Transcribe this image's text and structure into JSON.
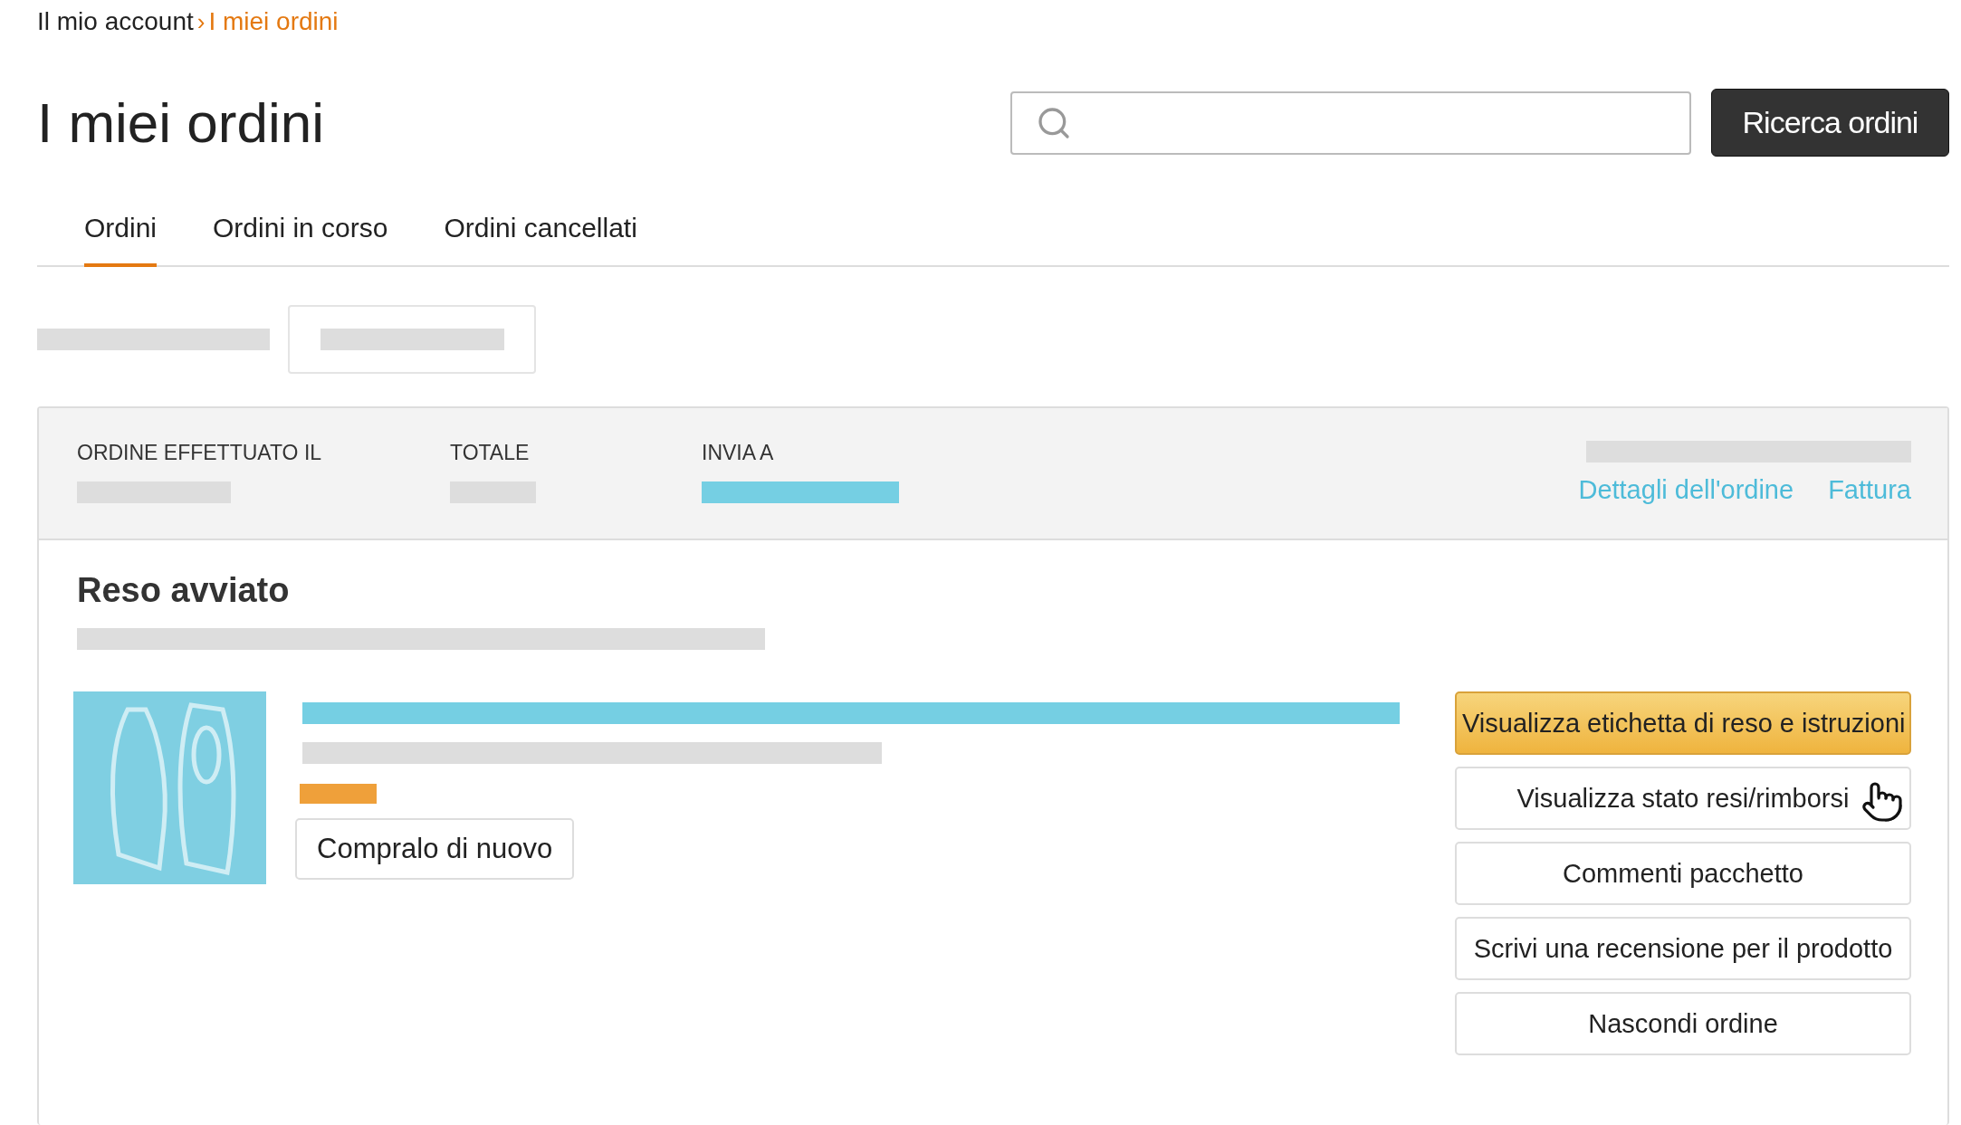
{
  "breadcrumb": [
    {
      "label": "Il mio account",
      "selected": false
    },
    {
      "label": "I miei ordini",
      "selected": true
    }
  ],
  "breadcrumb_separator": "›",
  "title": "I miei ordini",
  "search": {
    "button": "Ricerca ordini"
  },
  "tabs": [
    {
      "label": "Ordini",
      "selected": true
    },
    {
      "label": "Ordini in corso",
      "selected": false
    },
    {
      "label": "Ordini cancellati",
      "selected": false
    }
  ],
  "order": {
    "header": {
      "columns": [
        "ORDINE EFFETTUATO IL",
        "TOTALE",
        "INVIA A"
      ],
      "links": [
        "Dettagli dell'ordine",
        "Fattura"
      ]
    },
    "status": "Reso avviato",
    "buy_again": "Compralo di nuovo",
    "actions": [
      {
        "label": "Visualizza etichetta di reso e istruzioni",
        "kind": "primary"
      },
      {
        "label": "Visualizza stato resi/rimborsi",
        "kind": "secondary"
      },
      {
        "label": "Commenti pacchetto",
        "kind": "secondary"
      },
      {
        "label": "Scrivi una recensione per il prodotto",
        "kind": "secondary"
      },
      {
        "label": "Nascondi ordine",
        "kind": "secondary"
      }
    ]
  }
}
